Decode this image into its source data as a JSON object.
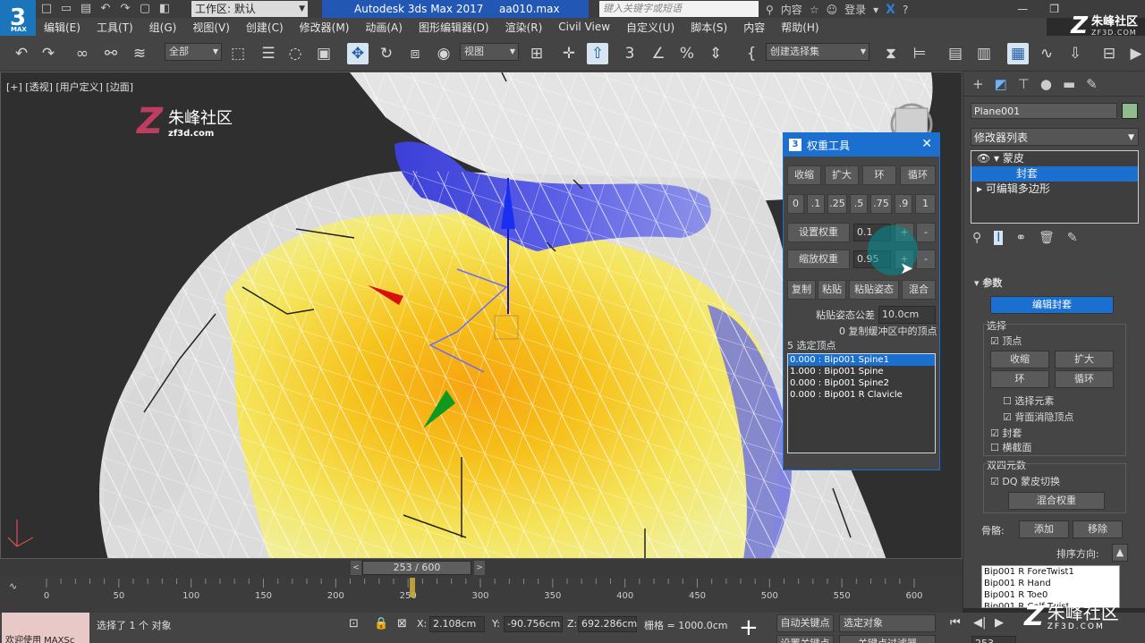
{
  "titlebar": {
    "workspace_label": "工作区: 默认",
    "app_name": "Autodesk 3ds Max 2017",
    "file_name": "aa010.max",
    "search_placeholder": "键入关键字或短语",
    "content_label": "内容",
    "login_label": "登录"
  },
  "watermark": {
    "brand": "朱峰社区",
    "site_top": "ZF3D.COM",
    "site_viewport": "zf3d.com",
    "site_bottom": "ZF3D.COM"
  },
  "menu": [
    "编辑(E)",
    "工具(T)",
    "组(G)",
    "视图(V)",
    "创建(C)",
    "修改器(M)",
    "动画(A)",
    "图形编辑器(D)",
    "渲染(R)",
    "Civil View",
    "自定义(U)",
    "脚本(S)",
    "内容",
    "帮助(H)"
  ],
  "toolbar": {
    "filter_label": "全部",
    "coord_label": "视图",
    "selset_label": "创建选择集",
    "accent": "#d7e4f2"
  },
  "viewport": {
    "label": "[+] [透视] [用户定义] [边面]"
  },
  "weight_tool": {
    "title": "权重工具",
    "shrink": "收缩",
    "grow": "扩大",
    "ring": "环",
    "loop": "循环",
    "presets": [
      "0",
      ".1",
      ".25",
      ".5",
      ".75",
      ".9",
      "1"
    ],
    "set_weight": "设置权重",
    "set_weight_value": "0.1",
    "scale_weight": "缩放权重",
    "scale_weight_value": "0.95",
    "plus": "+",
    "minus": "-",
    "copy": "复制",
    "paste": "粘贴",
    "paste_pos": "粘贴姿态",
    "blend": "混合",
    "paste_tol_label": "粘贴姿态公差",
    "paste_tol_value": "10.0cm",
    "buffer_text": "0 复制缓冲区中的顶点",
    "selected_text": "5 选定顶点",
    "weights": [
      {
        "text": "0.000 : Bip001 Spine1",
        "selected": true
      },
      {
        "text": "1.000 : Bip001 Spine",
        "selected": false
      },
      {
        "text": "0.000 : Bip001 Spine2",
        "selected": false
      },
      {
        "text": "0.000 : Bip001 R Clavicle",
        "selected": false
      }
    ]
  },
  "command_panel": {
    "object_name": "Plane001",
    "modifier_list": "修改器列表",
    "stack": [
      "蒙皮",
      "封套",
      "可编辑多边形"
    ],
    "params_title": "参数",
    "edit_envelope": "编辑封套",
    "select_group": "选择",
    "vertex_label": "顶点",
    "shrink": "收缩",
    "grow": "扩大",
    "ring": "环",
    "loop": "循环",
    "select_element": "选择元素",
    "backface_cull": "背面消隐顶点",
    "envelope_label": "封套",
    "cross_section": "横截面",
    "dq_group": "双四元数",
    "dq_toggle": "DQ 蒙皮切换",
    "blend_weights": "混合权重",
    "bones_label": "骨骼:",
    "add": "添加",
    "remove": "移除",
    "sort_label": "排序方向:",
    "bones": [
      "Bip001 R ForeTwist1",
      "Bip001 R Hand",
      "Bip001 R Toe0",
      "Bip001 R Calf Twist"
    ]
  },
  "timeline": {
    "frame_display": "253 / 600",
    "current_frame": 253,
    "start": 0,
    "end": 600,
    "ticks": [
      "0",
      "50",
      "100",
      "150",
      "200",
      "250",
      "300",
      "350",
      "400",
      "450",
      "500",
      "550",
      "600"
    ]
  },
  "status": {
    "maxscript": "欢迎使用 MAXSc",
    "selection_text": "选择了 1 个 对象",
    "x_label": "X:",
    "x_value": "2.108cm",
    "y_label": "Y:",
    "y_value": "-90.756cm",
    "z_label": "Z:",
    "z_value": "692.286cm",
    "grid_text": "栅格 = 1000.0cm",
    "autokey": "自动关键点",
    "set_key": "设置关键点",
    "selected_obj": "选定对象",
    "key_filter": "关键点过滤器",
    "frame_field": "253"
  }
}
